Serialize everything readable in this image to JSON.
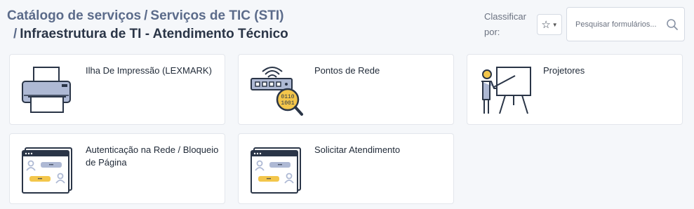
{
  "breadcrumb": {
    "items": [
      "Catálogo de serviços",
      "Serviços de TIC (STI)"
    ],
    "separator": "/",
    "current": "Infraestrutura de TI - Atendimento Técnico"
  },
  "toolbar": {
    "sort_label": "Classificar por:",
    "favorite_icon": "star-icon",
    "search_placeholder": "Pesquisar formulários...",
    "search_value": ""
  },
  "cards": [
    {
      "label": "Ilha De Impressão (LEXMARK)",
      "icon": "printer-icon"
    },
    {
      "label": "Pontos de Rede",
      "icon": "network-switch-icon"
    },
    {
      "label": "Projetores",
      "icon": "projector-presentation-icon"
    },
    {
      "label": "Autenticação na Rede / Bloqueio de Página",
      "icon": "browser-login-icon"
    },
    {
      "label": "Solicitar Atendimento",
      "icon": "browser-chat-icon"
    }
  ],
  "colors": {
    "outline": "#2a3547",
    "accent_blue": "#aeb9d4",
    "accent_yellow": "#f3c64b",
    "card_bg": "#ffffff",
    "page_bg": "#f5f7fa"
  }
}
